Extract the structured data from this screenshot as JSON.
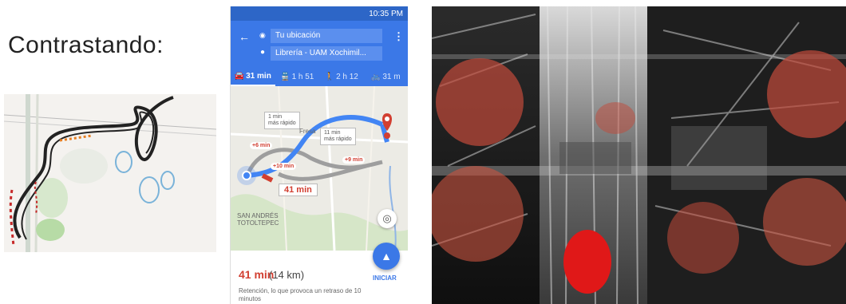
{
  "title": "Contrastando:",
  "phone": {
    "status_text": "10:35 PM",
    "origin": "Tu ubicación",
    "destination": "Librería - UAM Xochimil...",
    "modes": [
      {
        "icon": "car-icon",
        "glyph": "🚘",
        "label": "31 min"
      },
      {
        "icon": "transit-icon",
        "glyph": "🚆",
        "label": "1 h 51"
      },
      {
        "icon": "walk-icon",
        "glyph": "🚶",
        "label": "2 h 12"
      },
      {
        "icon": "bike-icon",
        "glyph": "🚲",
        "label": "31 m"
      }
    ],
    "map": {
      "bubble_faster": "1 min\nmás rápido",
      "bubble_faster2": "11 min\nmás rápido",
      "pill_plus6": "+6 min",
      "pill_plus9": "+9 min",
      "pill_plus10": "+10 min",
      "route_time": "41 min",
      "label_area": "SAN ANDRÉS\nTOTOLTEPEC",
      "label_road": "Fresa"
    },
    "eta_time": "41 min",
    "eta_distance": "(14 km)",
    "note": "Retención, lo que provoca un retraso de 10 minutos",
    "start_label": "INICIAR"
  }
}
